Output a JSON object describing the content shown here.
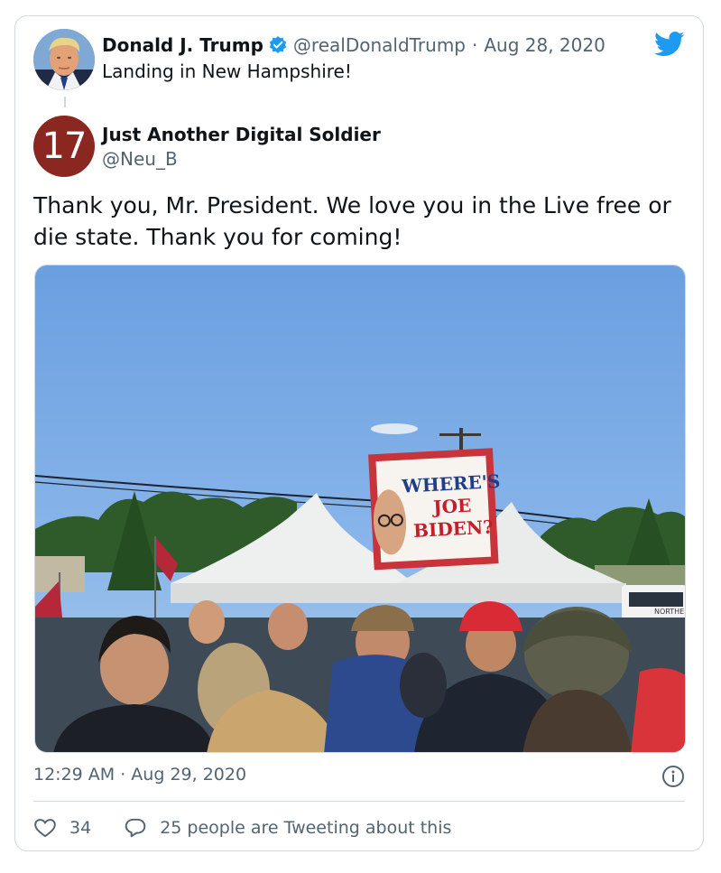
{
  "parent_tweet": {
    "author_name": "Donald J. Trump",
    "handle": "@realDonaldTrump",
    "separator": "·",
    "date": "Aug 28, 2020",
    "text": "Landing in New Hampshire!",
    "verified": true
  },
  "reply_tweet": {
    "avatar_text": "17",
    "author_name": "Just Another Digital Soldier",
    "handle": "@Neu_B",
    "text": "Thank you, Mr. President. We love you in the Live free or die state. Thank you for coming!",
    "sign_text": [
      "WHERE'S",
      "JOE",
      "BIDEN?"
    ],
    "bus_text": "NORTHE",
    "timestamp": "12:29 AM · Aug 29, 2020"
  },
  "footer": {
    "like_count": "34",
    "discussion_text": "25 people are Tweeting about this"
  },
  "icons": {
    "brand": "twitter-bird-icon",
    "verified": "verified-badge-icon",
    "info": "info-icon",
    "like": "heart-icon",
    "reply": "speech-bubble-icon"
  },
  "colors": {
    "twitter_blue": "#1d9bf0",
    "avatar_bg": "#8b2721",
    "muted_text": "#536471",
    "border": "#cfd9de"
  }
}
